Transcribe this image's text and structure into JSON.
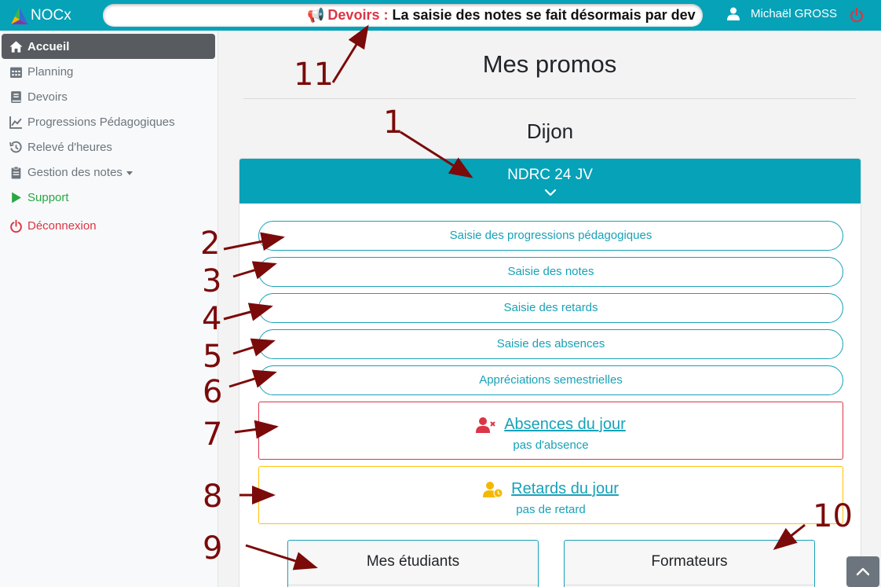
{
  "topbar": {
    "brand": "NOCx",
    "ticker": {
      "icon": "megaphone-icon",
      "tag": "Devoirs :",
      "message": "La saisie des notes se fait désormais par dev"
    },
    "user_name": "Michaël GROSS",
    "colors": {
      "primary": "#05a2b8",
      "danger": "#dc3545"
    }
  },
  "sidebar": {
    "items": [
      {
        "label": "Accueil",
        "icon": "home-icon"
      },
      {
        "label": "Planning",
        "icon": "calendar-icon"
      },
      {
        "label": "Devoirs",
        "icon": "book-icon"
      },
      {
        "label": "Progressions Pédagogiques",
        "icon": "chart-line-icon"
      },
      {
        "label": "Relevé d'heures",
        "icon": "history-icon"
      },
      {
        "label": "Gestion des notes",
        "icon": "clipboard-icon"
      },
      {
        "label": "Support",
        "icon": "play-icon"
      },
      {
        "label": "Déconnexion",
        "icon": "power-icon"
      }
    ]
  },
  "main": {
    "title": "Mes promos",
    "city": "Dijon",
    "promo": "NDRC 24 JV",
    "buttons": [
      "Saisie des progressions pédagogiques",
      "Saisie des notes",
      "Saisie des retards",
      "Saisie des absences",
      "Appréciations semestrielles"
    ],
    "absences": {
      "title": "Absences du jour",
      "status": "pas d'absence"
    },
    "retards": {
      "title": "Retards du jour",
      "status": "pas de retard"
    },
    "students_title": "Mes étudiants",
    "trainers_title": "Formateurs"
  },
  "annotations": [
    "1",
    "2",
    "3",
    "4",
    "5",
    "6",
    "7",
    "8",
    "9",
    "10",
    "11"
  ]
}
